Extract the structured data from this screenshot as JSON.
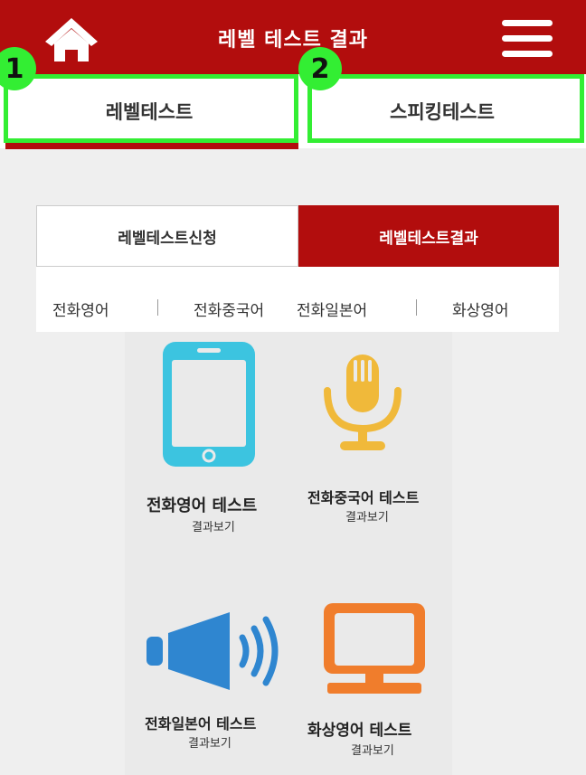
{
  "header": {
    "title": "레벨 테스트 결과",
    "home_icon": "home-icon",
    "menu_icon": "hamburger-menu-icon",
    "background": "#b20d0d"
  },
  "main_tabs": [
    {
      "label": "레벨테스트",
      "badge": "1",
      "active": true
    },
    {
      "label": "스피킹테스트",
      "badge": "2",
      "active": false
    }
  ],
  "sub_tabs": [
    {
      "label": "레벨테스트신청",
      "active": false
    },
    {
      "label": "레벨테스트결과",
      "active": true
    }
  ],
  "languages": [
    "전화영어",
    "전화중국어",
    "전화일본어",
    "화상영어"
  ],
  "cards": [
    {
      "title": "전화영어 테스트",
      "subtitle": "결과보기",
      "icon": "smartphone-icon",
      "color": "#3cc4e0"
    },
    {
      "title": "전화중국어 테스트",
      "subtitle": "결과보기",
      "icon": "microphone-icon",
      "color": "#f0b93a"
    },
    {
      "title": "전화일본어 테스트",
      "subtitle": "결과보기",
      "icon": "speaker-icon",
      "color": "#2f86d0"
    },
    {
      "title": "화상영어 테스트",
      "subtitle": "결과보기",
      "icon": "monitor-icon",
      "color": "#f07d2c"
    }
  ],
  "colors": {
    "accent": "#b20d0d",
    "highlight": "#33ee33"
  }
}
